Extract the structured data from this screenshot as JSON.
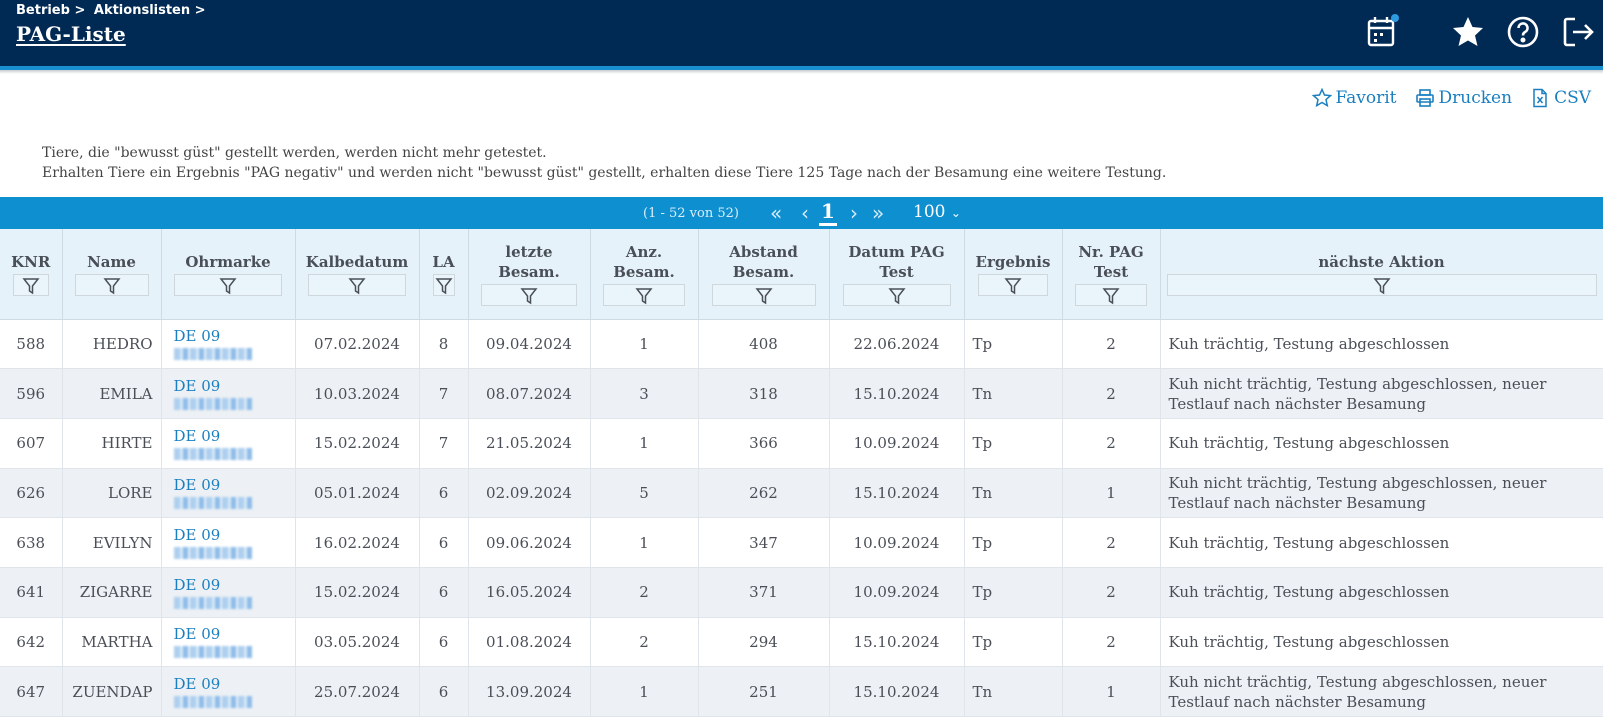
{
  "header": {
    "breadcrumb": [
      "Betrieb >",
      "Aktionslisten >"
    ],
    "title": "PAG-Liste"
  },
  "icons": {
    "calendar": "calendar-icon",
    "favorite": "star-icon",
    "help": "help-icon",
    "logout": "logout-icon"
  },
  "toolbar": {
    "favorit_label": "Favorit",
    "drucken_label": "Drucken",
    "csv_label": "CSV"
  },
  "info": {
    "line1": "Tiere, die \"bewusst güst\" gestellt werden, werden nicht mehr getestet.",
    "line2": "Erhalten Tiere ein Ergebnis \"PAG negativ\" und werden nicht \"bewusst güst\" gestellt, erhalten diese Tiere 125 Tage nach der Besamung eine weitere Testung."
  },
  "pager": {
    "range": "(1 - 52 von 52)",
    "first": "«",
    "prev": "‹",
    "current": "1",
    "next": "›",
    "last": "»",
    "page_size": "100"
  },
  "table": {
    "columns": [
      {
        "l1": "KNR",
        "l2": ""
      },
      {
        "l1": "Name",
        "l2": ""
      },
      {
        "l1": "Ohrmarke",
        "l2": ""
      },
      {
        "l1": "Kalbedatum",
        "l2": ""
      },
      {
        "l1": "LA",
        "l2": ""
      },
      {
        "l1": "letzte",
        "l2": "Besam."
      },
      {
        "l1": "Anz.",
        "l2": "Besam."
      },
      {
        "l1": "Abstand",
        "l2": "Besam."
      },
      {
        "l1": "Datum PAG",
        "l2": "Test"
      },
      {
        "l1": "Ergebnis",
        "l2": ""
      },
      {
        "l1": "Nr. PAG",
        "l2": "Test"
      },
      {
        "l1": "nächste Aktion",
        "l2": ""
      }
    ],
    "rows": [
      {
        "knr": "588",
        "name": "HEDRO",
        "ohrmarke": "DE 09",
        "kalbedatum": "07.02.2024",
        "la": "8",
        "letzte": "09.04.2024",
        "anz": "1",
        "abstand": "408",
        "datum": "22.06.2024",
        "ergebnis": "Tp",
        "nr": "2",
        "aktion": "Kuh trächtig, Testung abgeschlossen"
      },
      {
        "knr": "596",
        "name": "EMILA",
        "ohrmarke": "DE 09",
        "kalbedatum": "10.03.2024",
        "la": "7",
        "letzte": "08.07.2024",
        "anz": "3",
        "abstand": "318",
        "datum": "15.10.2024",
        "ergebnis": "Tn",
        "nr": "2",
        "aktion": "Kuh nicht trächtig, Testung abgeschlossen, neuer Testlauf nach nächster Besamung"
      },
      {
        "knr": "607",
        "name": "HIRTE",
        "ohrmarke": "DE 09",
        "kalbedatum": "15.02.2024",
        "la": "7",
        "letzte": "21.05.2024",
        "anz": "1",
        "abstand": "366",
        "datum": "10.09.2024",
        "ergebnis": "Tp",
        "nr": "2",
        "aktion": "Kuh trächtig, Testung abgeschlossen"
      },
      {
        "knr": "626",
        "name": "LORE",
        "ohrmarke": "DE 09",
        "kalbedatum": "05.01.2024",
        "la": "6",
        "letzte": "02.09.2024",
        "anz": "5",
        "abstand": "262",
        "datum": "15.10.2024",
        "ergebnis": "Tn",
        "nr": "1",
        "aktion": "Kuh nicht trächtig, Testung abgeschlossen, neuer Testlauf nach nächster Besamung"
      },
      {
        "knr": "638",
        "name": "EVILYN",
        "ohrmarke": "DE 09",
        "kalbedatum": "16.02.2024",
        "la": "6",
        "letzte": "09.06.2024",
        "anz": "1",
        "abstand": "347",
        "datum": "10.09.2024",
        "ergebnis": "Tp",
        "nr": "2",
        "aktion": "Kuh trächtig, Testung abgeschlossen"
      },
      {
        "knr": "641",
        "name": "ZIGARRE",
        "ohrmarke": "DE 09",
        "kalbedatum": "15.02.2024",
        "la": "6",
        "letzte": "16.05.2024",
        "anz": "2",
        "abstand": "371",
        "datum": "10.09.2024",
        "ergebnis": "Tp",
        "nr": "2",
        "aktion": "Kuh trächtig, Testung abgeschlossen"
      },
      {
        "knr": "642",
        "name": "MARTHA",
        "ohrmarke": "DE 09",
        "kalbedatum": "03.05.2024",
        "la": "6",
        "letzte": "01.08.2024",
        "anz": "2",
        "abstand": "294",
        "datum": "15.10.2024",
        "ergebnis": "Tp",
        "nr": "2",
        "aktion": "Kuh trächtig, Testung abgeschlossen"
      },
      {
        "knr": "647",
        "name": "ZUENDAP",
        "ohrmarke": "DE 09",
        "kalbedatum": "25.07.2024",
        "la": "6",
        "letzte": "13.09.2024",
        "anz": "1",
        "abstand": "251",
        "datum": "15.10.2024",
        "ergebnis": "Tn",
        "nr": "1",
        "aktion": "Kuh nicht trächtig, Testung abgeschlossen, neuer Testlauf nach nächster Besamung"
      }
    ]
  },
  "colors": {
    "header_bg": "#002a54",
    "accent": "#0e8fcf",
    "link": "#1a7fc0",
    "table_header_bg": "#e6f2fa",
    "row_alt": "#edf1f5"
  }
}
